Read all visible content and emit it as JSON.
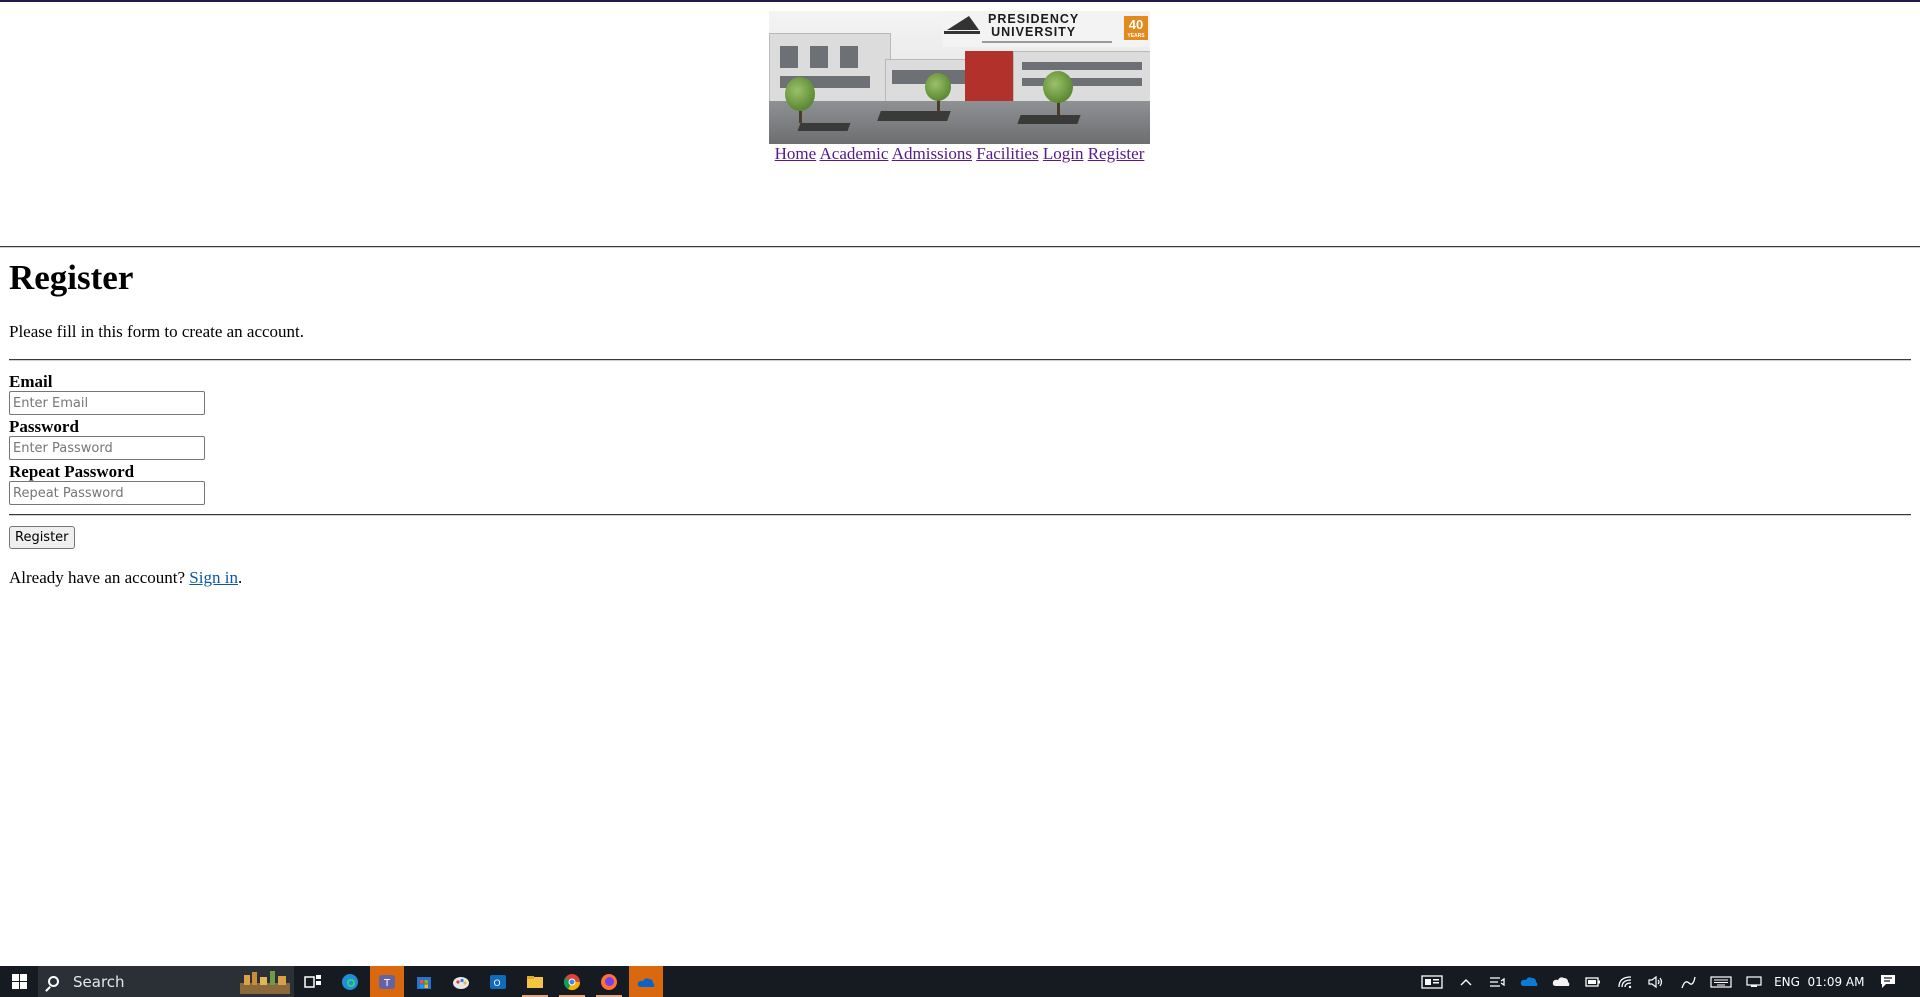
{
  "header": {
    "logo": {
      "title_line1": "PRESIDENCY",
      "title_line2": "UNIVERSITY",
      "badge": "40"
    },
    "nav": [
      "Home",
      "Academic",
      "Admissions",
      "Facilities",
      "Login",
      "Register"
    ]
  },
  "form": {
    "title": "Register",
    "intro": "Please fill in this form to create an account.",
    "email_label": "Email",
    "email_placeholder": "Enter Email",
    "password_label": "Password",
    "password_placeholder": "Enter Password",
    "repeat_label": "Repeat Password",
    "repeat_placeholder": "Repeat Password",
    "submit_label": "Register",
    "signin_prefix": "Already have an account?",
    "signin_link": "Sign in",
    "signin_suffix": "."
  },
  "taskbar": {
    "search_placeholder": "Search",
    "apps": [
      "task-view-icon",
      "edge-icon",
      "teams-icon",
      "store-icon",
      "paint-icon",
      "outlook-icon",
      "file-explorer-icon",
      "chrome-icon",
      "firefox-icon",
      "onedrive-app-icon"
    ],
    "tray": {
      "language": "ENG",
      "time": "01:09 AM"
    }
  },
  "colors": {
    "link_visited": "#551a8b",
    "link": "#0b57a4",
    "taskbar_bg": "#161b22",
    "taskbar_active": "#d9680f"
  }
}
